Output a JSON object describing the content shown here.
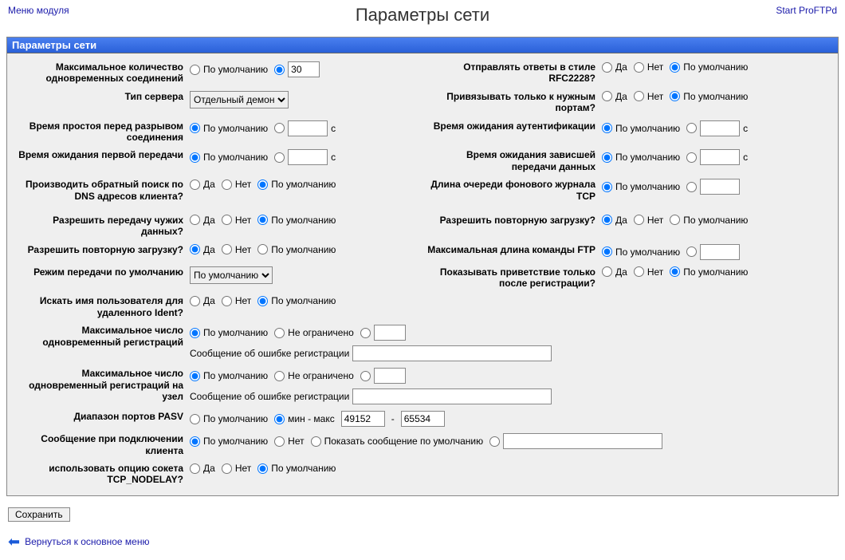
{
  "header": {
    "module_menu": "Меню модуля",
    "title": "Параметры сети",
    "start_link": "Start ProFTPd"
  },
  "panel_title": "Параметры сети",
  "labels": {
    "default": "По умолчанию",
    "yes": "Да",
    "no": "Нет",
    "unlimited": "Не ограничено",
    "s": "с",
    "show_default_msg": "Показать сообщение по умолчанию",
    "min_max": "мин - макс",
    "error_msg": "Сообщение об ошибке регистрации",
    "dash": "-"
  },
  "left": {
    "max_conn": {
      "label": "Максимальное количество одновременных соединений",
      "value": "30"
    },
    "server_type": {
      "label": "Тип сервера",
      "selected": "Отдельный демон"
    },
    "idle_timeout": {
      "label": "Время простоя перед разрывом соединения",
      "value": ""
    },
    "first_xfer_timeout": {
      "label": "Время ожидания первой передачи",
      "value": ""
    },
    "reverse_dns": {
      "label": "Производить обратный поиск по DNS адресов клиента?"
    },
    "foreign_xfer": {
      "label": "Разрешить передачу чужих данных?"
    },
    "allow_retrieve": {
      "label": "Разрешить повторную загрузку?"
    },
    "xfer_mode": {
      "label": "Режим передачи по умолчанию",
      "selected": "По умолчанию"
    },
    "ident_lookup": {
      "label": "Искать имя пользователя для удаленного Ident?"
    },
    "max_logins": {
      "label": "Максимальное число одновременный регистраций",
      "value": ""
    },
    "max_logins_host": {
      "label": "Максимальное число одновременный регистраций на узел",
      "value": ""
    },
    "pasv_range": {
      "label": "Диапазон портов PASV",
      "min": "49152",
      "max": "65534"
    },
    "conn_msg": {
      "label": "Сообщение при подключении клиента",
      "value": ""
    },
    "tcp_nodelay": {
      "label": "использовать опцию сокета TCP_NODELAY?"
    }
  },
  "right": {
    "rfc2228": {
      "label": "Отправлять ответы в стиле RFC2228?"
    },
    "bind_ports": {
      "label": "Привязывать только к нужным портам?"
    },
    "auth_timeout": {
      "label": "Время ожидания аутентификации",
      "value": ""
    },
    "stalled_timeout": {
      "label": "Время ожидания зависшей передачи данных",
      "value": ""
    },
    "tcp_backlog": {
      "label": "Длина очереди фонового журнала TCP",
      "value": ""
    },
    "allow_restart": {
      "label": "Разрешить повторную загрузку?"
    },
    "max_ftp_cmd": {
      "label": "Максимальная длина команды FTP",
      "value": ""
    },
    "defer_welcome": {
      "label": "Показывать приветствие только после регистрации?"
    }
  },
  "save": "Сохранить",
  "back": "Вернуться к основное меню"
}
